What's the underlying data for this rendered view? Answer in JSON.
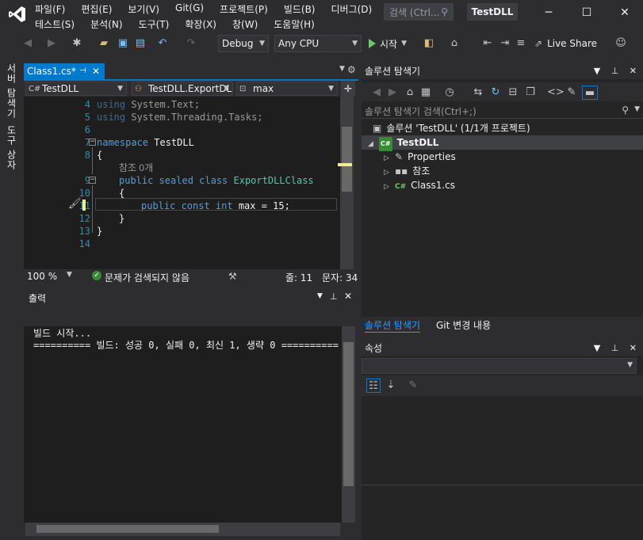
{
  "menu": {
    "row1": [
      "파일(F)",
      "편집(E)",
      "보기(V)",
      "Git(G)",
      "프로젝트(P)",
      "빌드(B)",
      "디버그(D)"
    ],
    "row2": [
      "테스트(S)",
      "분석(N)",
      "도구(T)",
      "확장(X)",
      "창(W)",
      "도움말(H)"
    ]
  },
  "search": {
    "placeholder": "검색 (Ctrl...",
    "icon": "search-icon"
  },
  "solution_title": "TestDLL",
  "toolbar": {
    "config": "Debug",
    "platform": "Any CPU",
    "start_label": "시작",
    "live_share": "Live Share"
  },
  "left_tabs": {
    "server_explorer": "서버 탐색기",
    "toolbox": "도구 상자"
  },
  "editor": {
    "tab_title": "Class1.cs*",
    "nav_project": "TestDLL",
    "nav_class": "TestDLL.ExportDL",
    "nav_member": "max",
    "lines": [
      {
        "n": "4"
      },
      {
        "n": "5"
      },
      {
        "n": "6"
      },
      {
        "n": "7"
      },
      {
        "n": "8"
      },
      {
        "n": "9"
      },
      {
        "n": "10"
      },
      {
        "n": "11"
      },
      {
        "n": "12"
      },
      {
        "n": "13"
      },
      {
        "n": "14"
      }
    ],
    "code": {
      "l4_kw": "using",
      "l4_rest": " System.Text;",
      "l5_kw": "using",
      "l5_rest": " System.Threading.Tasks;",
      "l7_kw": "namespace",
      "l7_rest": " TestDLL",
      "l8": "{",
      "ref_label": "참조 0개",
      "l9_kw": "public sealed class",
      "l9_cls": " ExportDLLClass",
      "l10": "{",
      "l11_kw": "public const int",
      "l11_rest": " max = 15;",
      "l12": "}",
      "l13": "}"
    },
    "status": {
      "zoom": "100 %",
      "issues": "문제가 검색되지 않음",
      "line": "줄: 11",
      "char": "문자: 34"
    }
  },
  "output": {
    "title": "출력",
    "lines": [
      "빌드 시작...",
      "========== 빌드: 성공 0, 실패 0, 최신 1, 생략 0 =========="
    ]
  },
  "solution_explorer": {
    "title": "솔루션 탐색기",
    "search_placeholder": "솔루션 탐색기 검색(Ctrl+;)",
    "solution_node": "솔루션 'TestDLL' (1/1개 프로젝트)",
    "project_node": "TestDLL",
    "children": [
      "Properties",
      "참조",
      "Class1.cs"
    ],
    "bottom_tabs": [
      "솔루션 탐색기",
      "Git 변경 내용"
    ]
  },
  "properties": {
    "title": "속성"
  },
  "colors": {
    "accent": "#007acc",
    "play": "#6fc66c",
    "keyword": "#569cd6",
    "type": "#4ec9b0"
  }
}
